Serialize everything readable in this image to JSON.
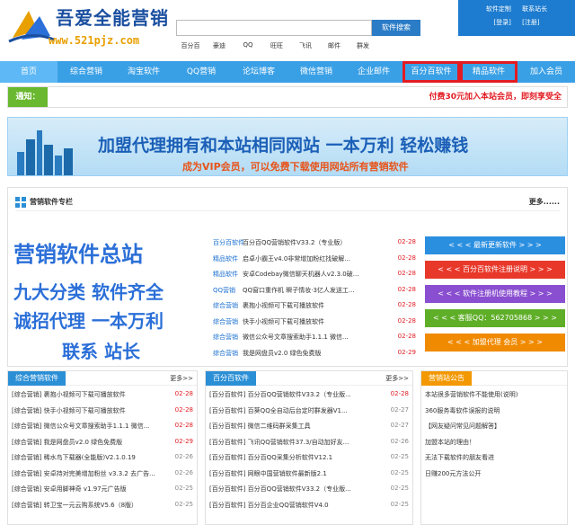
{
  "header": {
    "logo_title": "吾爱全能营销",
    "logo_url": "www.521pjz.com",
    "search_button": "软件搜索",
    "search_placeholder": "",
    "quick_links": [
      "百分百",
      "豪迪",
      "QQ",
      "旺旺",
      "飞讯",
      "邮件",
      "群发"
    ],
    "user_links_top": [
      "软件定制",
      "联系站长"
    ],
    "user_links_bottom": [
      "[登录]",
      "[注册]"
    ]
  },
  "nav": {
    "items": [
      {
        "label": "首页",
        "active": true,
        "highlight": false
      },
      {
        "label": "综合营销",
        "active": false,
        "highlight": false
      },
      {
        "label": "淘宝软件",
        "active": false,
        "highlight": false
      },
      {
        "label": "QQ营销",
        "active": false,
        "highlight": false
      },
      {
        "label": "论坛博客",
        "active": false,
        "highlight": false
      },
      {
        "label": "微信营销",
        "active": false,
        "highlight": false
      },
      {
        "label": "企业邮件",
        "active": false,
        "highlight": false
      },
      {
        "label": "百分百软件",
        "active": false,
        "highlight": true
      },
      {
        "label": "精品软件",
        "active": false,
        "highlight": true
      },
      {
        "label": "加入会员",
        "active": false,
        "highlight": false
      }
    ]
  },
  "notice": {
    "label": "通知：",
    "message": "付费30元加入本站会员，即刻享受全"
  },
  "banner": {
    "title": "加盟代理拥有和本站相同网站 一本万利 轻松赚钱",
    "subtitle": "成为VIP会员，可以免费下载使用网站所有营销软件"
  },
  "main": {
    "title": "营销软件专栏",
    "more": "更多......",
    "ad_lines": [
      "营销软件总站",
      "九大分类 软件齐全",
      "诚招代理 一本万利",
      "联系 站长"
    ],
    "news": [
      {
        "cat": "百分百软件",
        "title": "百分百QQ营销软件V33.2（专业版）",
        "date": "02-28"
      },
      {
        "cat": "精品软件",
        "title": "启卓小霸王v4.0非常增加粉红找破解...",
        "date": "02-28"
      },
      {
        "cat": "精品软件",
        "title": "安卓Codebay微信聊天机器人v2.3.0破...",
        "date": "02-28"
      },
      {
        "cat": "QQ营销",
        "title": "QQ窗口重作机 瞬子情妆·3亿人发送工...",
        "date": "02-28"
      },
      {
        "cat": "综合营销",
        "title": "裹抱小视频可下载可播放软件",
        "date": "02-28"
      },
      {
        "cat": "综合营销",
        "title": "快手小视频可下载可播放软件",
        "date": "02-28"
      },
      {
        "cat": "综合营销",
        "title": "微信公众号文章搜索助手1.1.1 微信...",
        "date": "02-28"
      },
      {
        "cat": "综合营销",
        "title": "我是网盘员v2.0 绿色免费版",
        "date": "02-29"
      }
    ],
    "side_buttons": [
      {
        "label": "< < < 最新更新软件 > > >",
        "color": "#2b8fe0"
      },
      {
        "label": "< < < 百分百软件注册说明 > > >",
        "color": "#e8382a"
      },
      {
        "label": "< < < 软件注册机使用教程 > > >",
        "color": "#8a4fd0"
      },
      {
        "label": "< < < 客服QQ：562705868 > > >",
        "color": "#5fae28"
      },
      {
        "label": "< < < 加盟代理 会员 > > >",
        "color": "#f08a00"
      }
    ]
  },
  "col1": {
    "tab": "综合营销软件",
    "more": "更多>>",
    "rows": [
      {
        "title": "[综合营销] 裹抱小视频可下载可播放软件",
        "date": "02-28",
        "red": true
      },
      {
        "title": "[综合营销] 快手小视频可下载可播放软件",
        "date": "02-28",
        "red": true
      },
      {
        "title": "[综合营销] 微信公众号文章搜索助手1.1.1 微信...",
        "date": "02-28",
        "red": true
      },
      {
        "title": "[综合营销] 我是网盘员v2.0 绿色免费版",
        "date": "02-29",
        "red": true
      },
      {
        "title": "[综合营销] 稀水鸟下载器(全能版)V2.1.0.19",
        "date": "02-26",
        "red": false
      },
      {
        "title": "[综合营销] 安卓持对完美增加粉丝 v3.3.2 去广告...",
        "date": "02-26",
        "red": false
      },
      {
        "title": "[综合营销] 安卓用脚神奇 v1.97元广告版",
        "date": "02-25",
        "red": false
      },
      {
        "title": "[综合营销] 转卫宝一元云购系统V5.6（8版）",
        "date": "02-25",
        "red": false
      }
    ]
  },
  "col2": {
    "tab": "百分百软件",
    "more": "更多>>",
    "rows": [
      {
        "title": "[百分百软件] 百分百QQ营销软件V33.2（专业版...",
        "date": "02-28",
        "red": true
      },
      {
        "title": "[百分百软件] 百葵QQ全自动后台定时群发器V1...",
        "date": "02-27",
        "red": false
      },
      {
        "title": "[百分百软件] 微信二维码群采集工具",
        "date": "02-27",
        "red": false
      },
      {
        "title": "[百分百软件] 飞讯QQ营销软件37.3/自动加好友...",
        "date": "02-26",
        "red": false
      },
      {
        "title": "[百分百软件] 百分百QQ采集分析软件V12.1",
        "date": "02-25",
        "red": false
      },
      {
        "title": "[百分百软件] 网眼中国营销软件最新版2.1",
        "date": "02-25",
        "red": false
      },
      {
        "title": "[百分百软件] 百分百QQ营销软件V33.2（专业版...",
        "date": "02-25",
        "red": false
      },
      {
        "title": "[百分百软件] 百分百企业QQ营销软件V4.0",
        "date": "02-25",
        "red": false
      }
    ]
  },
  "col3": {
    "tab": "营销站公告",
    "rows": [
      "本站很多营销软件不能使用(说明)",
      "360服务毒软件误报的说明",
      "【网友疑问常见问题解答】",
      "加盟本站的理由！",
      "无法下载软件的朋友看进",
      "日赚200元方法公开"
    ]
  },
  "colors": {
    "nav_bg": "#3aa0e6",
    "highlight_box": "#e21c22",
    "date_red": "#e21c22"
  }
}
